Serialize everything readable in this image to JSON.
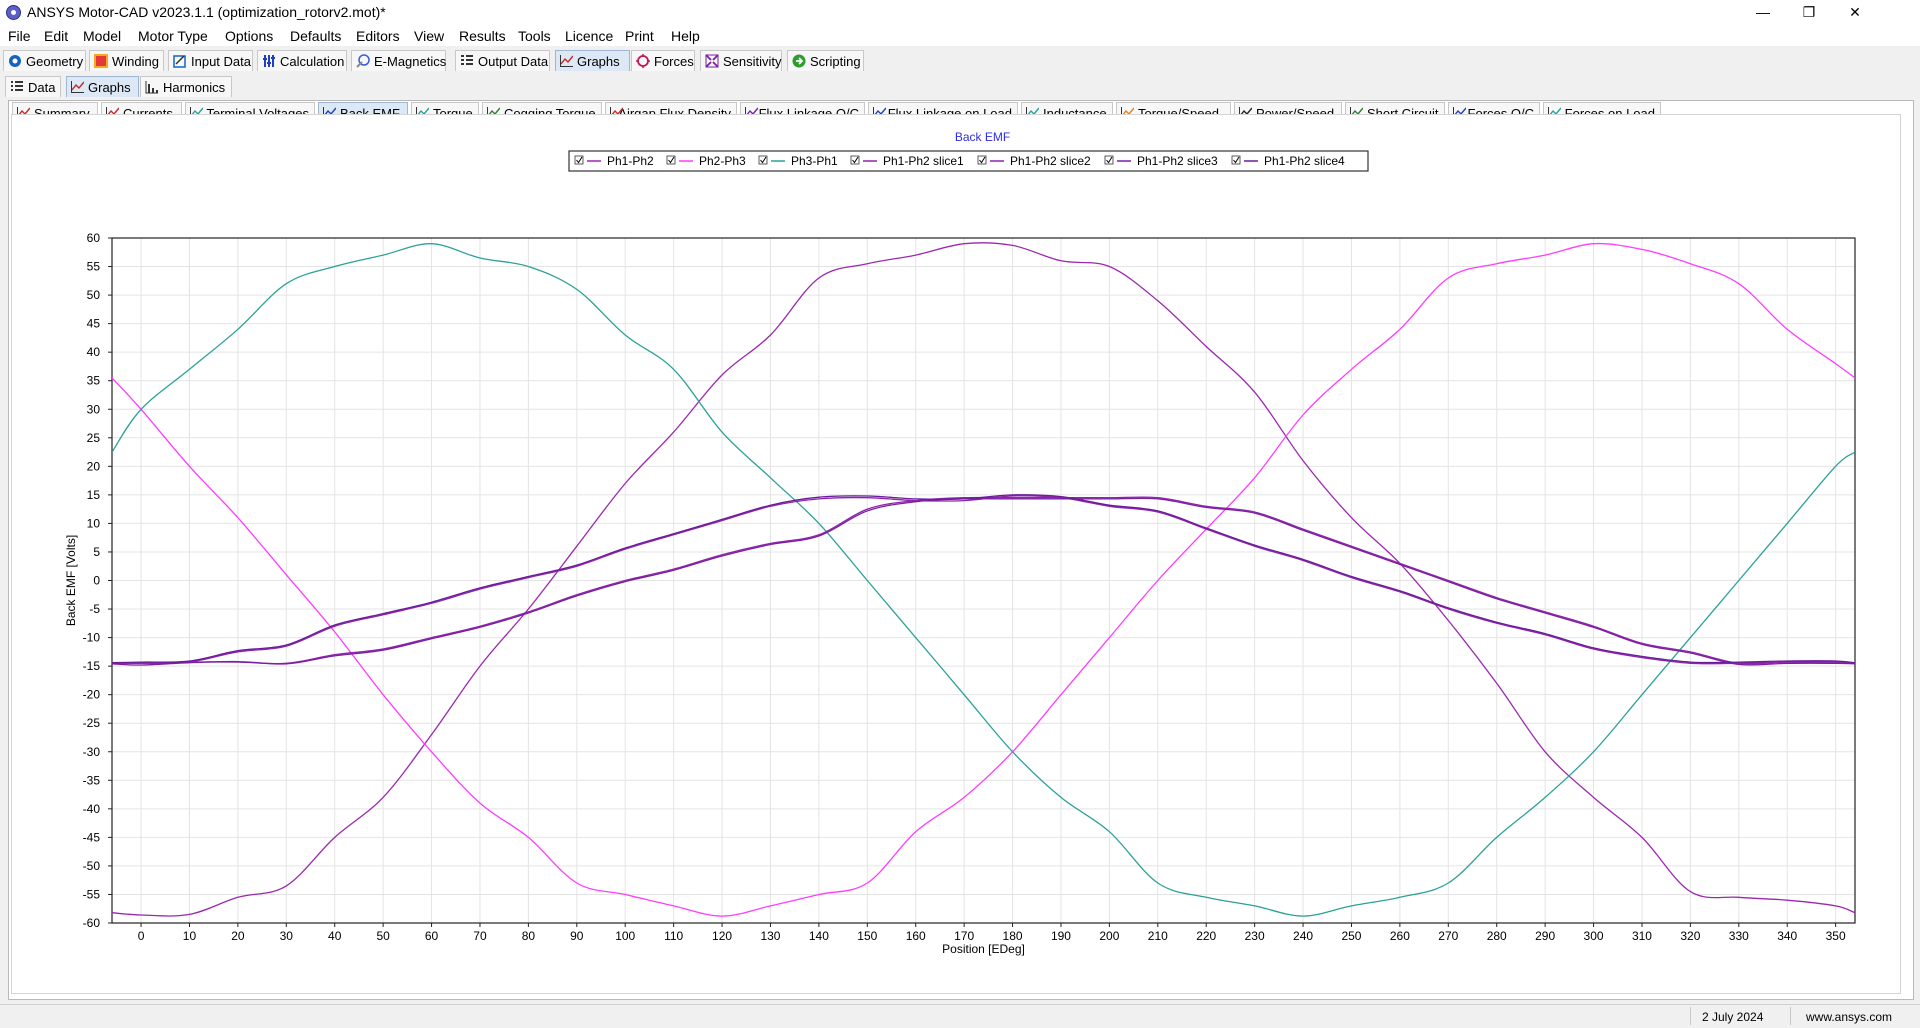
{
  "window": {
    "title": "ANSYS Motor-CAD v2023.1.1 (optimization_rotorv2.mot)*",
    "controls": [
      "—",
      "❐",
      "✕"
    ]
  },
  "menu": [
    "File",
    "Edit",
    "Model",
    "Motor Type",
    "Options",
    "Defaults",
    "Editors",
    "View",
    "Results",
    "Tools",
    "Licence",
    "Print",
    "Help"
  ],
  "main_tabs": [
    {
      "label": "Geometry",
      "icon": "geometry-icon",
      "color": "#1565c0"
    },
    {
      "label": "Winding",
      "icon": "winding-icon",
      "color": "#e53935"
    },
    {
      "label": "Input Data",
      "icon": "input-data-icon",
      "color": "#1565c0"
    },
    {
      "label": "Calculation",
      "icon": "calculation-icon",
      "color": "#1e3fbf"
    },
    {
      "label": "E-Magnetics",
      "icon": "e-magnetics-icon",
      "color": "#3b5bdb"
    },
    {
      "label": "Output Data",
      "icon": "output-data-icon",
      "color": "#333333"
    },
    {
      "label": "Graphs",
      "icon": "graphs-icon",
      "color": "#c62828"
    },
    {
      "label": "Forces",
      "icon": "forces-icon",
      "color": "#c2185b"
    },
    {
      "label": "Sensitivity",
      "icon": "sensitivity-icon",
      "color": "#7b1fa2"
    },
    {
      "label": "Scripting",
      "icon": "scripting-icon",
      "color": "#2e9d2e"
    }
  ],
  "main_active": "Graphs",
  "sub_tabs": [
    {
      "label": "Data",
      "icon": "data-list-icon"
    },
    {
      "label": "Graphs",
      "icon": "graphs-icon"
    },
    {
      "label": "Harmonics",
      "icon": "harmonics-icon"
    }
  ],
  "sub_active": "Graphs",
  "graph_tabs": [
    {
      "label": "Summary",
      "color": "#c62828"
    },
    {
      "label": "Currents",
      "color": "#c62828"
    },
    {
      "label": "Terminal Voltages",
      "color": "#2aa198"
    },
    {
      "label": "Back EMF",
      "color": "#1e3fbf"
    },
    {
      "label": "Torque",
      "color": "#2aa198"
    },
    {
      "label": "Cogging Torque",
      "color": "#2e7d32"
    },
    {
      "label": "Airgap Flux Density",
      "color": "#c62828"
    },
    {
      "label": "Flux Linkage O/C",
      "color": "#7b1fa2"
    },
    {
      "label": "Flux Linkage on Load",
      "color": "#1e3fbf"
    },
    {
      "label": "Inductance",
      "color": "#2aa198"
    },
    {
      "label": "Torque/Speed",
      "color": "#e67e22"
    },
    {
      "label": "Power/Speed",
      "color": "#222222"
    },
    {
      "label": "Short Circuit",
      "color": "#2e7d32"
    },
    {
      "label": "Forces O/C",
      "color": "#1e3fbf"
    },
    {
      "label": "Forces on Load",
      "color": "#2aa198"
    }
  ],
  "graph_active": "Back EMF",
  "status": {
    "date": "2 July 2024",
    "site": "www.ansys.com"
  },
  "chart_data": {
    "type": "line",
    "title": "Back EMF",
    "xlabel": "Position [EDeg]",
    "ylabel": "Back EMF [Volts]",
    "xlim": [
      -6,
      354
    ],
    "ylim": [
      -60,
      60
    ],
    "xticks": [
      0,
      10,
      20,
      30,
      40,
      50,
      60,
      70,
      80,
      90,
      100,
      110,
      120,
      130,
      140,
      150,
      160,
      170,
      180,
      190,
      200,
      210,
      220,
      230,
      240,
      250,
      260,
      270,
      280,
      290,
      300,
      310,
      320,
      330,
      340,
      350
    ],
    "yticks": [
      -60,
      -55,
      -50,
      -45,
      -40,
      -35,
      -30,
      -25,
      -20,
      -15,
      -10,
      -5,
      0,
      5,
      10,
      15,
      20,
      25,
      30,
      35,
      40,
      45,
      50,
      55,
      60
    ],
    "grid": true,
    "legend_position": "top-center",
    "x": [
      -6,
      0,
      10,
      20,
      30,
      40,
      50,
      60,
      70,
      80,
      90,
      100,
      110,
      120,
      130,
      140,
      150,
      160,
      170,
      180,
      190,
      200,
      210,
      220,
      230,
      240,
      250,
      260,
      270,
      280,
      290,
      300,
      310,
      320,
      330,
      340,
      350,
      354
    ],
    "series": [
      {
        "name": "Ph1-Ph2",
        "color": "#9c27b0",
        "values": [
          -58.2,
          -58.6,
          -58.5,
          -55.5,
          -53.5,
          -45,
          -38,
          -27,
          -15,
          -5,
          6,
          17,
          26,
          36,
          43,
          53,
          55.5,
          57,
          59,
          58.7,
          56,
          55,
          49,
          41,
          33,
          21,
          11,
          3,
          -7,
          -18,
          -30,
          -38,
          -45,
          -54.5,
          -55.5,
          -56,
          -57,
          -58.2
        ]
      },
      {
        "name": "Ph2-Ph3",
        "color": "#ff3cff",
        "values": [
          35.5,
          30,
          20,
          11,
          1,
          -9,
          -20,
          -30,
          -39,
          -45,
          -53,
          -55,
          -57,
          -58.8,
          -57,
          -55,
          -53,
          -44,
          -38,
          -30,
          -20,
          -10,
          0,
          9,
          18,
          29,
          37,
          44,
          53,
          55.5,
          57,
          59,
          58,
          55.5,
          52,
          44,
          38,
          35.5
        ]
      },
      {
        "name": "Ph3-Ph1",
        "color": "#2aa198",
        "values": [
          22.5,
          30,
          37,
          44,
          52,
          55,
          57,
          59,
          56.5,
          55,
          51,
          43,
          37,
          26,
          18,
          10,
          0,
          -10,
          -20,
          -30,
          -38,
          -44,
          -53,
          -55.5,
          -57,
          -58.8,
          -57,
          -55.5,
          -53,
          -45,
          -38,
          -30,
          -20,
          -10,
          0,
          10,
          20,
          22.5
        ]
      },
      {
        "name": "Ph1-Ph2 slice1",
        "color": "#8e24aa",
        "values": [
          -14.5,
          -14.5,
          -14.3,
          -14.3,
          -14.5,
          -13,
          -12,
          -10,
          -8,
          -5.5,
          -2.5,
          0,
          2,
          4.5,
          6.5,
          8,
          12.5,
          14,
          14.5,
          14.5,
          14.5,
          14.5,
          14.5,
          13,
          12,
          9,
          6,
          3,
          0,
          -3,
          -5.5,
          -8,
          -11,
          -12.5,
          -14.5,
          -14.3,
          -14.3,
          -14.5
        ]
      },
      {
        "name": "Ph1-Ph2 slice2",
        "color": "#8e24aa",
        "values": [
          -14.5,
          -14.5,
          -14.3,
          -12.5,
          -11.5,
          -8,
          -6,
          -4,
          -1.5,
          0.5,
          2.5,
          5.5,
          8,
          10.5,
          13,
          14.3,
          14.5,
          14,
          14,
          14.8,
          14.5,
          13,
          12,
          9,
          6,
          3.5,
          0.5,
          -2,
          -5,
          -7.5,
          -9.5,
          -12,
          -13.5,
          -14.5,
          -14.5,
          -14.3,
          -14.3,
          -14.5
        ]
      },
      {
        "name": "Ph1-Ph2 slice3",
        "color": "#7b1fa2",
        "values": [
          -14.6,
          -14.8,
          -14.4,
          -14.2,
          -14.6,
          -13.2,
          -12.2,
          -10.2,
          -8.2,
          -5.7,
          -2.7,
          -0.2,
          1.8,
          4.3,
          6.3,
          7.8,
          12.2,
          13.8,
          14.3,
          14.3,
          14.3,
          14.3,
          14.3,
          12.8,
          11.8,
          8.8,
          5.8,
          2.8,
          -0.2,
          -3.2,
          -5.7,
          -8.2,
          -11.2,
          -12.7,
          -14.7,
          -14.5,
          -14.5,
          -14.6
        ]
      },
      {
        "name": "Ph1-Ph2 slice4",
        "color": "#6a1b9a",
        "values": [
          -14.4,
          -14.3,
          -14.1,
          -12.3,
          -11.3,
          -7.8,
          -5.8,
          -3.8,
          -1.3,
          0.7,
          2.7,
          5.7,
          8.2,
          10.7,
          13.2,
          14.6,
          14.8,
          14.3,
          14.3,
          15,
          14.7,
          13.2,
          12.2,
          9.2,
          6.2,
          3.7,
          0.7,
          -1.8,
          -4.8,
          -7.3,
          -9.3,
          -11.8,
          -13.3,
          -14.3,
          -14.3,
          -14.1,
          -14.1,
          -14.4
        ]
      }
    ]
  }
}
